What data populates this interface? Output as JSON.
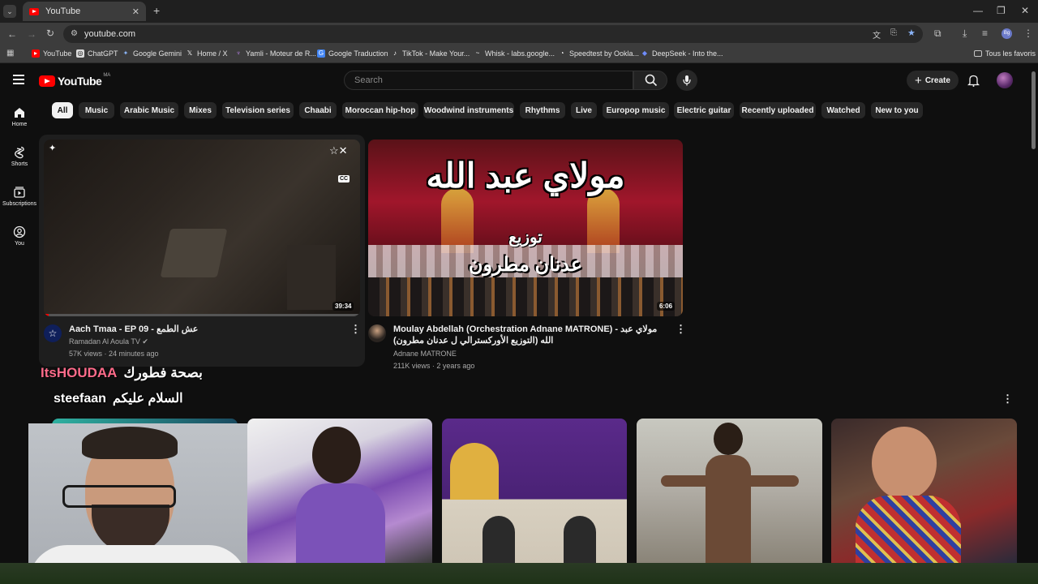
{
  "browser": {
    "tab_title": "YouTube",
    "url": "youtube.com",
    "bookmarks": [
      "YouTube",
      "ChatGPT",
      "Google Gemini",
      "Home / X",
      "Yamli - Moteur de R...",
      "Google Traduction",
      "TikTok - Make Your...",
      "Whisk - labs.google...",
      "Speedtest by Ookla...",
      "DeepSeek - Into the..."
    ],
    "all_bookmarks": "Tous les favoris"
  },
  "youtube": {
    "logo_text": "YouTube",
    "region": "MA",
    "search_placeholder": "Search",
    "create_label": "Create"
  },
  "sidebar": [
    {
      "label": "Home",
      "icon": "home-icon"
    },
    {
      "label": "Shorts",
      "icon": "shorts-icon"
    },
    {
      "label": "Subscriptions",
      "icon": "subscriptions-icon"
    },
    {
      "label": "You",
      "icon": "you-icon"
    }
  ],
  "chips": [
    "All",
    "Music",
    "Arabic Music",
    "Mixes",
    "Television series",
    "Chaabi",
    "Moroccan hip-hop",
    "Woodwind instruments",
    "Rhythms",
    "Live",
    "Europop music",
    "Electric guitar",
    "Recently uploaded",
    "Watched",
    "New to you"
  ],
  "videos": [
    {
      "title": "Aach Tmaa - EP 09 - عش الطمع",
      "channel": "Ramadan Al Aoula TV",
      "meta": "57K views · 24 minutes ago",
      "duration": "39:34"
    },
    {
      "title": "Moulay Abdellah (Orchestration Adnane MATRONE) - مولاي عبد الله (التوزيع الأوركسترالي ل عدنان مطرون)",
      "channel": "Adnane MATRONE",
      "meta": "211K views · 2 years ago",
      "duration": "6:06",
      "thumb_text_1": "مولاي عبد الله",
      "thumb_text_2": "توزيع",
      "thumb_text_3": "عدنان مطرون"
    }
  ],
  "overlay": {
    "line1_a": "ItsHOUDAA",
    "line1_b": "بصحة فطورك",
    "line2_a": "steefaan",
    "line2_b": "السلام عليكم"
  },
  "colors": {
    "accent_red": "#ff0000",
    "background": "#0f0f0f"
  }
}
